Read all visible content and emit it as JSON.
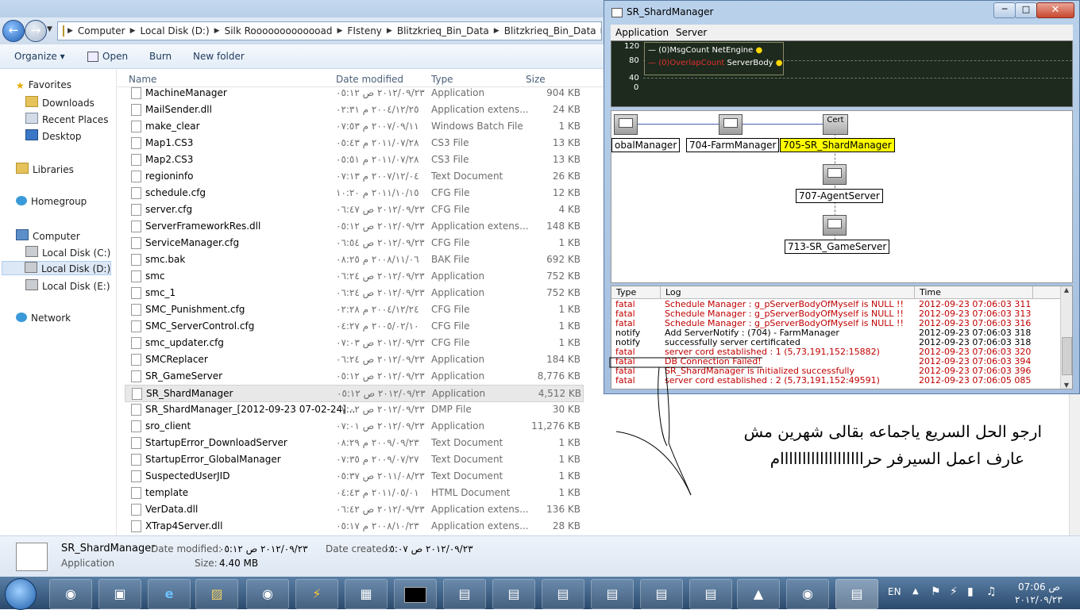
{
  "explorer": {
    "breadcrumb": [
      "Computer",
      "Local Disk (D:)",
      "Silk Rooooooooooooad",
      "FIsteny",
      "Blitzkrieq_Bin_Data",
      "Blitzkrieq_Bin_Data"
    ],
    "toolbar": {
      "organize": "Organize ▾",
      "open": "Open",
      "burn": "Burn",
      "new_folder": "New folder"
    },
    "nav": {
      "favorites": "Favorites",
      "downloads": "Downloads",
      "recent": "Recent Places",
      "desktop": "Desktop",
      "libraries": "Libraries",
      "homegroup": "Homegroup",
      "computer": "Computer",
      "disk_c": "Local Disk (C:)",
      "disk_d": "Local Disk (D:)",
      "disk_e": "Local Disk (E:)",
      "network": "Network"
    },
    "columns": {
      "name": "Name",
      "date": "Date modified",
      "type": "Type",
      "size": "Size"
    },
    "files": [
      {
        "name": "MachineManager",
        "date": "٢٠١٢/٠٩/٢٣ ص ٠٥:١٢",
        "type": "Application",
        "size": "904 KB"
      },
      {
        "name": "MailSender.dll",
        "date": "٢٠٠٤/١٢/٢٥ م ٠٢:٣١",
        "type": "Application extens...",
        "size": "24 KB"
      },
      {
        "name": "make_clear",
        "date": "٢٠٠٧/٠٩/١١ م ٠٧:٥٣",
        "type": "Windows Batch File",
        "size": "1 KB"
      },
      {
        "name": "Map1.CS3",
        "date": "٢٠١١/٠٧/٢٨ م ٠٥:٤٣",
        "type": "CS3 File",
        "size": "13 KB"
      },
      {
        "name": "Map2.CS3",
        "date": "٢٠١١/٠٧/٢٨ م ٠٥:٥١",
        "type": "CS3 File",
        "size": "13 KB"
      },
      {
        "name": "regioninfo",
        "date": "٢٠٠٧/١٢/٠٤ م ٠٧:١٣",
        "type": "Text Document",
        "size": "26 KB"
      },
      {
        "name": "schedule.cfg",
        "date": "٢٠١١/١٠/١٥ م ١٠:٢٠",
        "type": "CFG File",
        "size": "12 KB"
      },
      {
        "name": "server.cfg",
        "date": "٢٠١٢/٠٩/٢٣ ص ٠٦:٤٧",
        "type": "CFG File",
        "size": "4 KB"
      },
      {
        "name": "ServerFrameworkRes.dll",
        "date": "٢٠١٢/٠٩/٢٣ ص ٠٥:١٢",
        "type": "Application extens...",
        "size": "148 KB"
      },
      {
        "name": "ServiceManager.cfg",
        "date": "٢٠١٢/٠٩/٢٣ ص ٠٦:٥٤",
        "type": "CFG File",
        "size": "1 KB"
      },
      {
        "name": "smc.bak",
        "date": "٢٠٠٨/١١/٠٦ م ٠٨:٢٥",
        "type": "BAK File",
        "size": "692 KB"
      },
      {
        "name": "smc",
        "date": "٢٠١٢/٠٩/٢٣ ص ٠٦:٢٤",
        "type": "Application",
        "size": "752 KB"
      },
      {
        "name": "smc_1",
        "date": "٢٠١٢/٠٩/٢٣ ص ٠٦:٢٤",
        "type": "Application",
        "size": "752 KB"
      },
      {
        "name": "SMC_Punishment.cfg",
        "date": "٢٠٠٤/١٢/٢٤ م ٠٢:٢٨",
        "type": "CFG File",
        "size": "1 KB"
      },
      {
        "name": "SMC_ServerControl.cfg",
        "date": "٢٠٠٥/٠٢/١٠ م ٠٤:٢٧",
        "type": "CFG File",
        "size": "1 KB"
      },
      {
        "name": "smc_updater.cfg",
        "date": "٢٠١٢/٠٩/٢٣ ص ٠٧:٠٣",
        "type": "CFG File",
        "size": "1 KB"
      },
      {
        "name": "SMCReplacer",
        "date": "٢٠١٢/٠٩/٢٣ ص ٠٦:٢٤",
        "type": "Application",
        "size": "184 KB"
      },
      {
        "name": "SR_GameServer",
        "date": "٢٠١٢/٠٩/٢٣ ص ٠٥:١٢",
        "type": "Application",
        "size": "8,776 KB"
      },
      {
        "name": "SR_ShardManager",
        "date": "٢٠١٢/٠٩/٢٣ ص ٠٥:١٢",
        "type": "Application",
        "size": "4,512 KB"
      },
      {
        "name": "SR_ShardManager_[2012-09-23 07-02-24]...",
        "date": "٢٠١٢/٠٩/٢٣ ص ٠٧:٠٢",
        "type": "DMP File",
        "size": "30 KB"
      },
      {
        "name": "sro_client",
        "date": "٢٠١٢/٠٩/٢٣ ص ٠٧:٠١",
        "type": "Application",
        "size": "11,276 KB"
      },
      {
        "name": "StartupError_DownloadServer",
        "date": "٢٠٠٩/٠٩/٢٣ م ٠٨:٢٩",
        "type": "Text Document",
        "size": "1 KB"
      },
      {
        "name": "StartupError_GlobalManager",
        "date": "٢٠٠٩/٠٧/٢٧ م ٠٧:٣٥",
        "type": "Text Document",
        "size": "1 KB"
      },
      {
        "name": "SuspectedUserJID",
        "date": "٢٠١١/٠٨/٢٣ ص ٠٥:٣٧",
        "type": "Text Document",
        "size": "1 KB"
      },
      {
        "name": "template",
        "date": "٢٠١١/٠٥/٠١ م ٠٤:٤٣",
        "type": "HTML Document",
        "size": "1 KB"
      },
      {
        "name": "VerData.dll",
        "date": "٢٠١٢/٠٩/٢٣ ص ٠٦:٤٢",
        "type": "Application extens...",
        "size": "136 KB"
      },
      {
        "name": "XTrap4Server.dll",
        "date": "٢٠٠٨/١٠/٢٣ م ٠٥:١٧",
        "type": "Application extens...",
        "size": "28 KB"
      }
    ],
    "selected_index": 18,
    "details": {
      "name": "SR_ShardManager",
      "type": "Application",
      "modified_label": "Date modified:",
      "modified": "٢٠١٢/٠٩/٢٣ ص ٠٥:١٢",
      "created_label": "Date created:",
      "created": "٢٠١٢/٠٩/٢٣ ص ٠٥:٠٧",
      "size_label": "Size:",
      "size": "4.40 MB"
    }
  },
  "shard": {
    "title": "SR_ShardManager",
    "menu": [
      "Application",
      "Server"
    ],
    "graph": {
      "yticks": [
        "120",
        "80",
        "40",
        "0"
      ],
      "legend1_label": "(0)MsgCount",
      "legend1_name": "NetEngine",
      "legend2_label": "(0)OverlapCount",
      "legend2_name": "ServerBody"
    },
    "nodes": {
      "global": "obalManager",
      "farm": "704-FarmManager",
      "shard": "705-SR_ShardManager",
      "agent": "707-AgentServer",
      "game": "713-SR_GameServer",
      "cert": "Cert"
    },
    "log_headers": {
      "type": "Type",
      "log": "Log",
      "time": "Time"
    },
    "logs": [
      {
        "type": "fatal",
        "msg": "Schedule Manager : g_pServerBodyOfMyself is NULL !!",
        "time": "2012-09-23 07:06:03 311",
        "level": "fatal"
      },
      {
        "type": "fatal",
        "msg": "Schedule Manager : g_pServerBodyOfMyself is NULL !!",
        "time": "2012-09-23 07:06:03 313",
        "level": "fatal"
      },
      {
        "type": "fatal",
        "msg": "Schedule Manager : g_pServerBodyOfMyself is NULL !!",
        "time": "2012-09-23 07:06:03 316",
        "level": "fatal"
      },
      {
        "type": "notify",
        "msg": "Add ServerNotify : (704) - FarmManager",
        "time": "2012-09-23 07:06:03 318",
        "level": "notify"
      },
      {
        "type": "notify",
        "msg": "successfully server certificated",
        "time": "2012-09-23 07:06:03 318",
        "level": "notify"
      },
      {
        "type": "fatal",
        "msg": "server cord established : 1 (5,73,191,152:15882)",
        "time": "2012-09-23 07:06:03 320",
        "level": "fatal"
      },
      {
        "type": "fatal",
        "msg": "DB Connection Failed!",
        "time": "2012-09-23 07:06:03 394",
        "level": "fatal"
      },
      {
        "type": "fatal",
        "msg": "SR_ShardManager is initialized successfully",
        "time": "2012-09-23 07:06:03 396",
        "level": "fatal"
      },
      {
        "type": "fatal",
        "msg": "server cord established : 2 (5,73,191,152:49591)",
        "time": "2012-09-23 07:06:05 085",
        "level": "fatal"
      }
    ]
  },
  "annotation": {
    "line1": "ارجو الحل السريع ياجماعه بقالى شهرين  مش",
    "line2": "عارف اعمل السيرفر حرااااااااااااااااااام"
  },
  "taskbar": {
    "lang": "EN",
    "time": "07:06 ص",
    "date": "٢٠١٢/٠٩/٢٣"
  },
  "colors": {
    "fatal": "#c00000",
    "notify": "#000000",
    "highlight": "#ffff00",
    "graph_bg": "#1d2a1d"
  }
}
